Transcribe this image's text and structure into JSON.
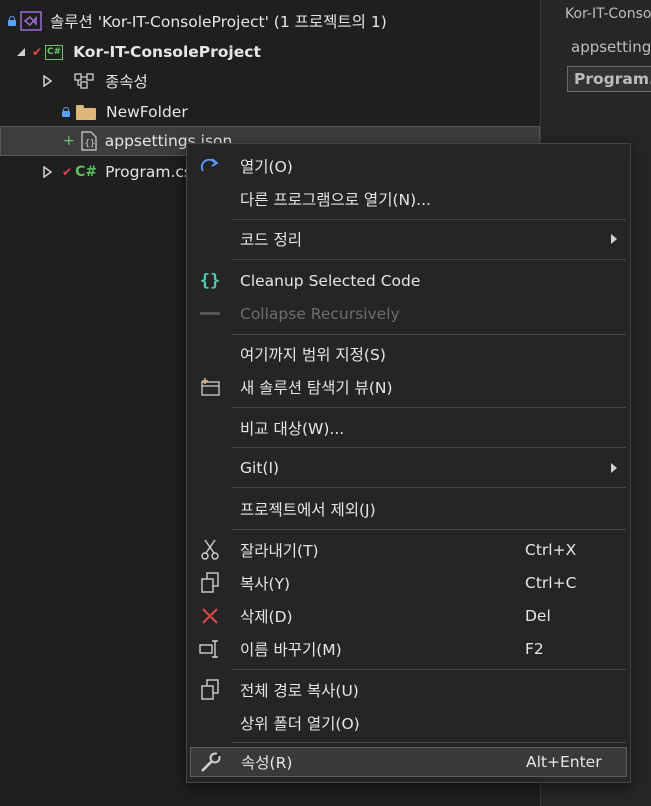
{
  "tree": {
    "solution_label": "솔루션 'Kor-IT-ConsoleProject' (1 프로젝트의 1)",
    "project_label": "Kor-IT-ConsoleProject",
    "dependencies_label": "종속성",
    "folder_label": "NewFolder",
    "selected_file_label": "appsettings.json",
    "program_label": "Program.cs",
    "cs_badge": "C#"
  },
  "right_panel": {
    "tab1": "Kor-IT-Console",
    "tab2": "appsettings",
    "tab3": "Program.cs"
  },
  "menu": {
    "open": "열기(O)",
    "open_with": "다른 프로그램으로 열기(N)...",
    "code_cleanup": "코드 정리",
    "cleanup_selected": "Cleanup Selected Code",
    "collapse_recursively": "Collapse Recursively",
    "scope_to_this": "여기까지 범위 지정(S)",
    "new_solution_explorer_view": "새 솔루션 탐색기 뷰(N)",
    "compare_with": "비교 대상(W)...",
    "git": "Git(I)",
    "exclude_from_project": "프로젝트에서 제외(J)",
    "cut": "잘라내기(T)",
    "cut_shortcut": "Ctrl+X",
    "copy": "복사(Y)",
    "copy_shortcut": "Ctrl+C",
    "delete": "삭제(D)",
    "delete_shortcut": "Del",
    "rename": "이름 바꾸기(M)",
    "rename_shortcut": "F2",
    "copy_full_path": "전체 경로 복사(U)",
    "open_containing_folder": "상위 폴더 열기(O)",
    "properties": "속성(R)",
    "properties_shortcut": "Alt+Enter"
  },
  "colors": {
    "accent_blue": "#5aa0ff",
    "cs_green": "#6fc36f",
    "delete_red": "#e04848",
    "folder_yellow": "#dcb67a"
  },
  "icons": [
    "redo-arrow-icon",
    "curly-braces-icon",
    "collapse-icon",
    "new-window-icon",
    "scissors-icon",
    "copy-icon",
    "delete-x-icon",
    "rename-icon",
    "wrench-icon"
  ]
}
